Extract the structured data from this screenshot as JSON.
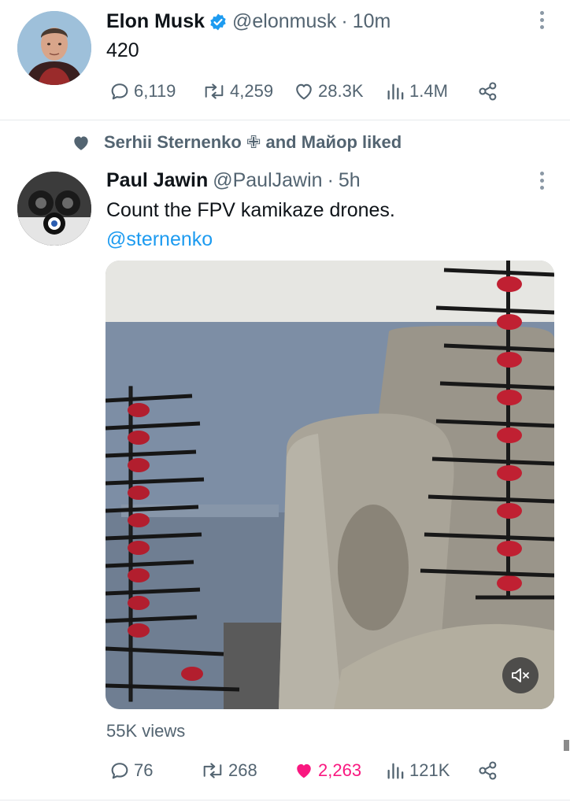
{
  "tweets": [
    {
      "name": "Elon Musk",
      "handle": "@elonmusk",
      "separator": "·",
      "time": "10m",
      "text": "420",
      "stats": {
        "replies": "6,119",
        "retweets": "4,259",
        "likes": "28.3K",
        "views": "1.4M"
      }
    },
    {
      "social_context": "Serhii Sternenko ✙ and Майор liked",
      "name": "Paul Jawin",
      "handle": "@PaulJawin",
      "separator": "·",
      "time": "5h",
      "text": "Count the FPV kamikaze drones.",
      "mention": "@sternenko",
      "view_count": "55K views",
      "stats": {
        "replies": "76",
        "retweets": "268",
        "likes": "2,263",
        "views": "121K"
      }
    }
  ],
  "colors": {
    "verified": "#1d9bf0",
    "mention": "#1d9bf0",
    "like_active": "#f91880",
    "secondary_text": "#536471"
  },
  "icons": [
    "verified-badge-icon",
    "more-icon",
    "reply-icon",
    "retweet-icon",
    "like-icon",
    "views-icon",
    "share-icon",
    "heart-icon",
    "mute-icon"
  ]
}
